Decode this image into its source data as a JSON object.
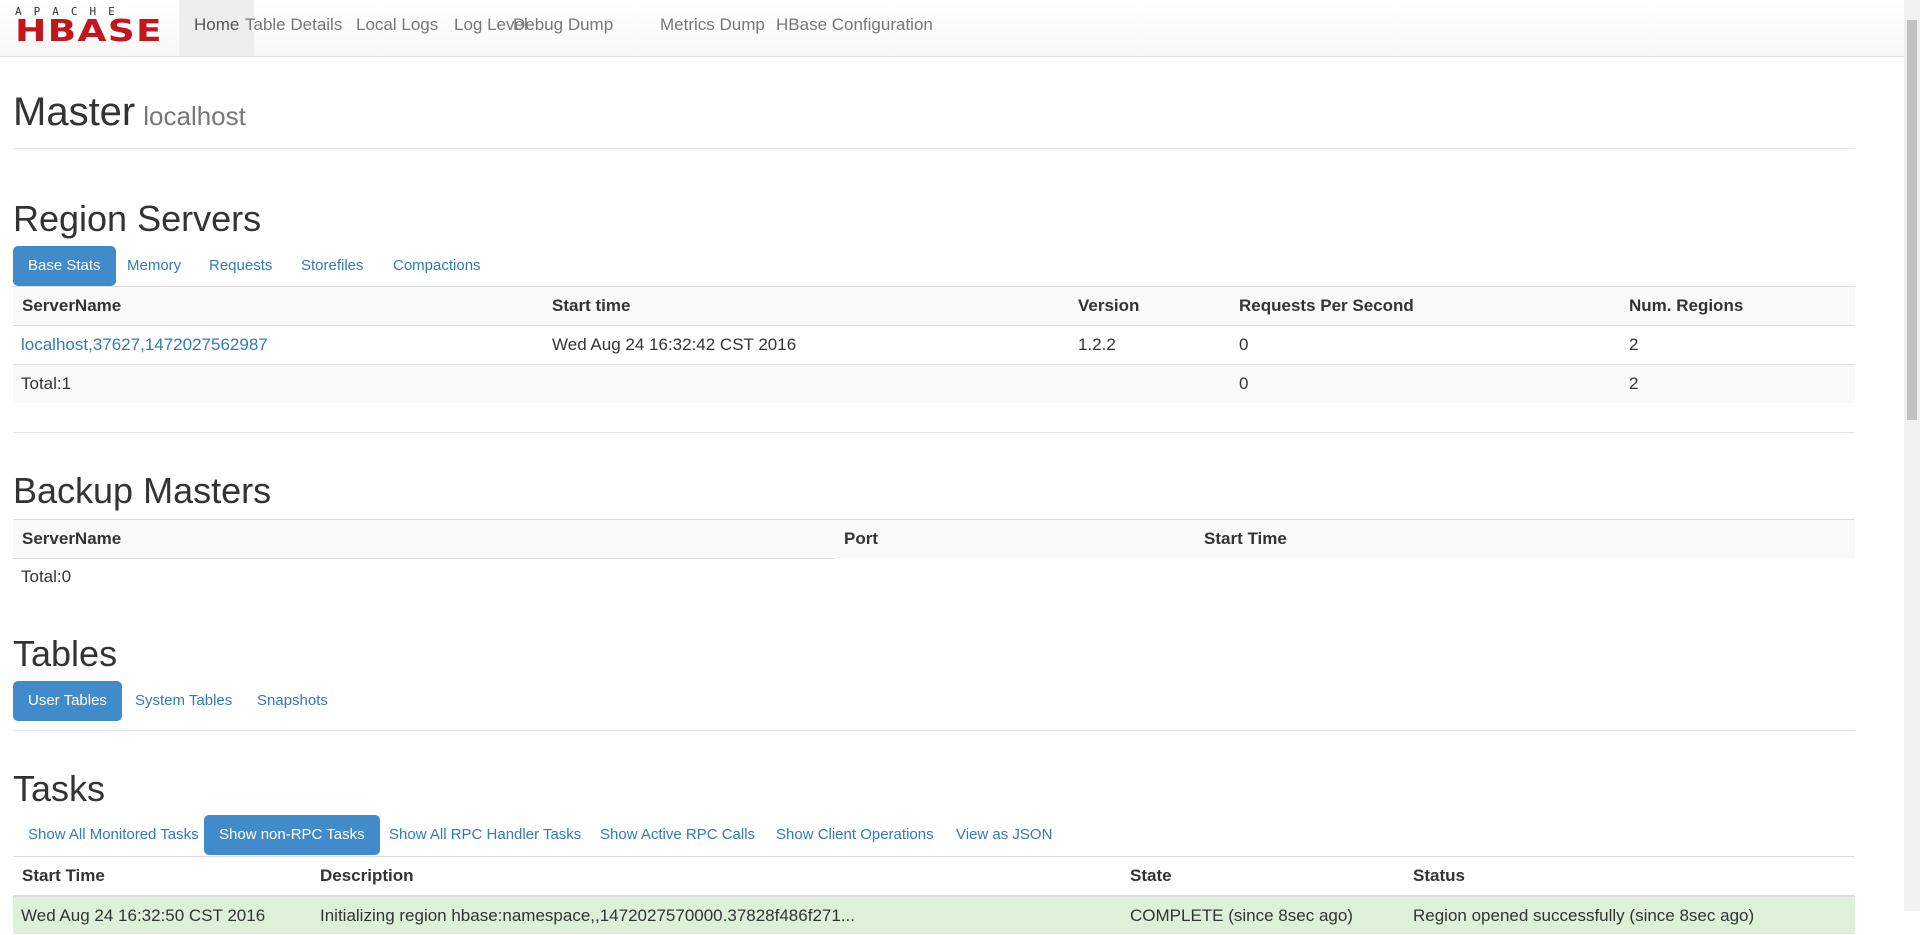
{
  "nav": {
    "logo_top": "APACHE",
    "logo_main": "HBASE",
    "items": [
      "Home",
      "Table Details",
      "Local Logs",
      "Log Level",
      "Debug Dump",
      "Metrics Dump",
      "HBase Configuration"
    ]
  },
  "header": {
    "title": "Master",
    "host": "localhost"
  },
  "region_servers": {
    "title": "Region Servers",
    "tabs": [
      "Base Stats",
      "Memory",
      "Requests",
      "Storefiles",
      "Compactions"
    ],
    "columns": [
      "ServerName",
      "Start time",
      "Version",
      "Requests Per Second",
      "Num. Regions"
    ],
    "rows": [
      [
        "localhost,37627,1472027562987",
        "Wed Aug 24 16:32:42 CST 2016",
        "1.2.2",
        "0",
        "2"
      ]
    ],
    "total": [
      "Total:1",
      "0",
      "2"
    ]
  },
  "backup_masters": {
    "title": "Backup Masters",
    "columns": [
      "ServerName",
      "Port",
      "Start Time"
    ],
    "total": "Total:0"
  },
  "tables": {
    "title": "Tables",
    "tabs": [
      "User Tables",
      "System Tables",
      "Snapshots"
    ]
  },
  "tasks": {
    "title": "Tasks",
    "tabs": [
      "Show All Monitored Tasks",
      "Show non-RPC Tasks",
      "Show All RPC Handler Tasks",
      "Show Active RPC Calls",
      "Show Client Operations",
      "View as JSON"
    ],
    "columns": [
      "Start Time",
      "Description",
      "State",
      "Status"
    ],
    "rows": [
      [
        "Wed Aug 24 16:32:50 CST 2016",
        "Initializing region hbase:namespace,,1472027570000.37828f486f271...",
        "COMPLETE (since 8sec ago)",
        "Region opened successfully (since 8sec ago)"
      ]
    ]
  }
}
